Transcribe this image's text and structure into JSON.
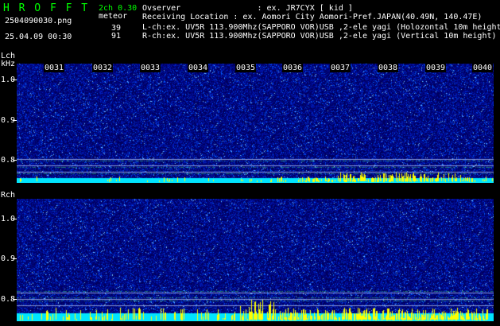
{
  "app": {
    "title": "H R O F F T",
    "filename": "2504090030.png",
    "datetime": "25.04.09 00:30",
    "mode": "2ch 0.30",
    "meteor_label": "meteor",
    "lch_count": "39",
    "rch_count": "91"
  },
  "info": {
    "observer": "Ovserver                : ex. JR7CYX [ kid ]",
    "location": "Receiving Location : ex. Aomori City Aomori-Pref.JAPAN(40.49N, 140.47E)",
    "lch": "L-ch:ex. UV5R 113.900Mhz(SAPPORO VOR)USB ,2-ele yagi (Holozontal 10m height)",
    "rch": "R-ch:ex. UV5R 113.900Mhz(SAPPORO VOR)USB ,2-ele yagi (Vertical 10m height)"
  },
  "lch_panel": {
    "channel_label": "Lch",
    "unit_label": "kHz",
    "y_labels": [
      "1.0",
      "0.9",
      "0.8"
    ],
    "minute_labels": [
      "0031",
      "0032",
      "0033",
      "0034",
      "0035",
      "0036",
      "0037",
      "0038",
      "0039",
      "0040"
    ]
  },
  "rch_panel": {
    "channel_label": "Rch",
    "y_labels": [
      "1.0",
      "0.9",
      "0.8"
    ]
  },
  "colors": {
    "background": "#000000",
    "header_green": "#00ff00",
    "noise_dark": "#00005a",
    "noise_bright": "#0050ff",
    "cyan": "#00e5ff",
    "yellow": "#ffff00"
  }
}
